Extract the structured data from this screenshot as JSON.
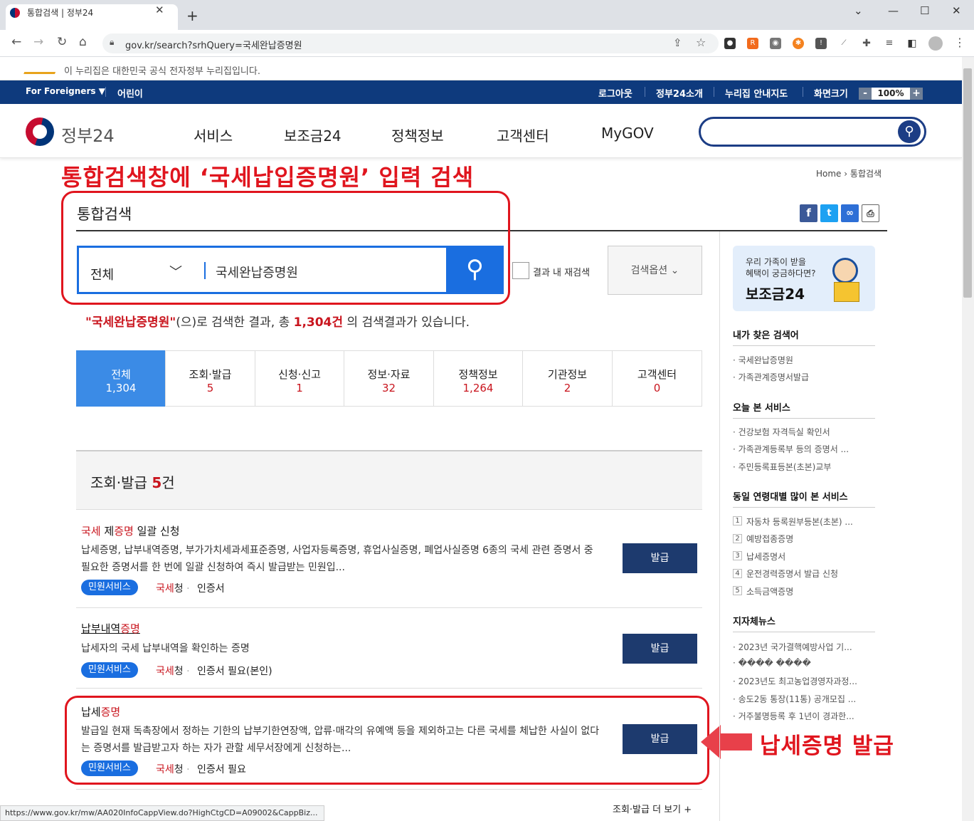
{
  "browser": {
    "tab_title": "통합검색 | 정부24",
    "url": "gov.kr/search?srhQuery=국세완납증명원",
    "status_url": "https://www.gov.kr/mw/AA020InfoCappView.do?HighCtgCD=A09002&CappBiz..."
  },
  "notice": "이 누리집은 대한민국 공식 전자정부 누리집입니다.",
  "topbar": {
    "foreigners": "For Foreigners ▼",
    "kids": "어린이",
    "logout": "로그아웃",
    "about": "정부24소개",
    "sitemap": "누리집 안내지도",
    "screen_size": "화면크기",
    "zoom_minus": "-",
    "zoom_value": "100%",
    "zoom_plus": "+"
  },
  "header": {
    "logo": "정부24",
    "nav": [
      "서비스",
      "보조금24",
      "정책정보",
      "고객센터",
      "MyGOV"
    ]
  },
  "annotation": {
    "top": "통합검색창에 ‘국세납입증명원’ 입력 검색",
    "issue": "납세증명 발급"
  },
  "breadcrumb": {
    "home": "Home",
    "sep": "›",
    "current": "통합검색"
  },
  "page_title": "통합검색",
  "search": {
    "category": "전체",
    "query": "국세완납증명원",
    "within_label": "결과 내 재검색",
    "options_label": "검색옵션 ⌄"
  },
  "summary": {
    "q_open": "\"국세완납증명원\"",
    "mid": "(으)로 검색한 결과, 총 ",
    "count": "1,304건",
    "end": " 의 검색결과가 있습니다."
  },
  "categories": [
    {
      "label": "전체",
      "count": "1,304"
    },
    {
      "label": "조회·발급",
      "count": "5"
    },
    {
      "label": "신청·신고",
      "count": "1"
    },
    {
      "label": "정보·자료",
      "count": "32"
    },
    {
      "label": "정책정보",
      "count": "1,264"
    },
    {
      "label": "기관정보",
      "count": "2"
    },
    {
      "label": "고객센터",
      "count": "0"
    }
  ],
  "section": {
    "title": "조회·발급",
    "count": "5",
    "unit": "건",
    "more": "조회·발급 더 보기  +"
  },
  "items": [
    {
      "title_parts": [
        "국세",
        " 제",
        "증명",
        " 일괄 신청"
      ],
      "desc": "납세증명, 납부내역증명, 부가가치세과세표준증명, 사업자등록증명, 휴업사실증명, 폐업사실증명 6종의 국세 관련 증명서 중 필요한 증명서를 한 번에 일괄 신청하여 즉시 발급받는 민원입...",
      "badge": "민원서비스",
      "org_a": "국세",
      "org_b": "청",
      "cert": "인증서",
      "button": "발급"
    },
    {
      "title_parts": [
        "납부내역",
        "증명"
      ],
      "desc": "납세자의 국세 납부내역을 확인하는 증명",
      "badge": "민원서비스",
      "org_a": "국세",
      "org_b": "청",
      "cert": "인증서 필요(본인)",
      "button": "발급"
    },
    {
      "title_parts": [
        "납세",
        "증명"
      ],
      "desc": "발급일 현재 독촉장에서 정하는 기한의 납부기한연장액, 압류·매각의 유예액 등을 제외하고는 다른 국세를 체납한 사실이 없다는 증명서를 발급받고자 하는 자가 관할 세무서장에게 신청하는...",
      "badge": "민원서비스",
      "org_a": "국세",
      "org_b": "청",
      "cert": "인증서 필요",
      "button": "발급"
    }
  ],
  "sidebar": {
    "banner_line1": "우리 가족이 받을",
    "banner_line2": "혜택이 궁금하다면?",
    "banner_big": "보조금24",
    "recent_h": "내가 찾은 검색어",
    "recent": [
      "국세완납증명원",
      "가족관계증명서발급"
    ],
    "today_h": "오늘 본 서비스",
    "today": [
      "건강보험 자격득실 확인서",
      "가족관계등록부 등의 증명서 ...",
      "주민등록표등본(초본)교부"
    ],
    "age_h": "동일 연령대별 많이 본 서비스",
    "age": [
      "자동차 등록원부등본(초본) ...",
      "예방접종증명",
      "납세증명서",
      "운전경력증명서 발급 신청",
      "소득금액증명"
    ],
    "news_h": "지자체뉴스",
    "news": [
      "2023년 국가결핵예방사업 기...",
      "���� ����",
      "2023년도 최고농업경영자과정...",
      "송도2동 통장(11통) 공개모집 ...",
      "거주불명등록 후 1년이 경과한..."
    ]
  }
}
